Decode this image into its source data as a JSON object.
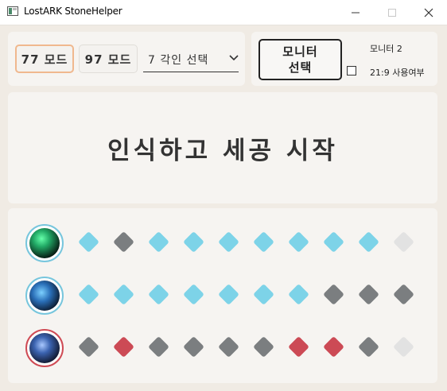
{
  "window": {
    "title": "LostARK StoneHelper",
    "minimize_icon": "minimize-icon",
    "maximize_icon": "maximize-icon",
    "close_icon": "close-icon"
  },
  "toolbar": {
    "mode77_label": "77 모드",
    "mode97_label": "97 모드",
    "selected_mode": "77 모드",
    "engrave_select_value": "7 각인 선택",
    "monitor_button_line1": "모니터",
    "monitor_button_line2": "선택",
    "monitor_current": "모니터 2",
    "ultrawide_checkbox_label": "21:9 사용여부",
    "ultrawide_checked": false
  },
  "start_button_label": "인식하고 세공 시작",
  "colors": {
    "success": "#7dd3e8",
    "fail": "#7b7e80",
    "fail_negative": "#cc4a55",
    "pending": "#e2e2e2",
    "badge_positive_border": "#77c6dd",
    "badge_negative_border": "#cf4b55"
  },
  "engrave_rows": [
    {
      "kind": "positive",
      "slots": [
        "success",
        "fail",
        "success",
        "success",
        "success",
        "success",
        "success",
        "success",
        "success",
        "pending"
      ]
    },
    {
      "kind": "positive",
      "slots": [
        "success",
        "success",
        "success",
        "success",
        "success",
        "success",
        "success",
        "fail",
        "fail",
        "fail"
      ]
    },
    {
      "kind": "negative",
      "slots": [
        "fail",
        "fail_negative",
        "fail",
        "fail",
        "fail",
        "fail",
        "fail_negative",
        "fail_negative",
        "fail",
        "pending"
      ]
    }
  ]
}
